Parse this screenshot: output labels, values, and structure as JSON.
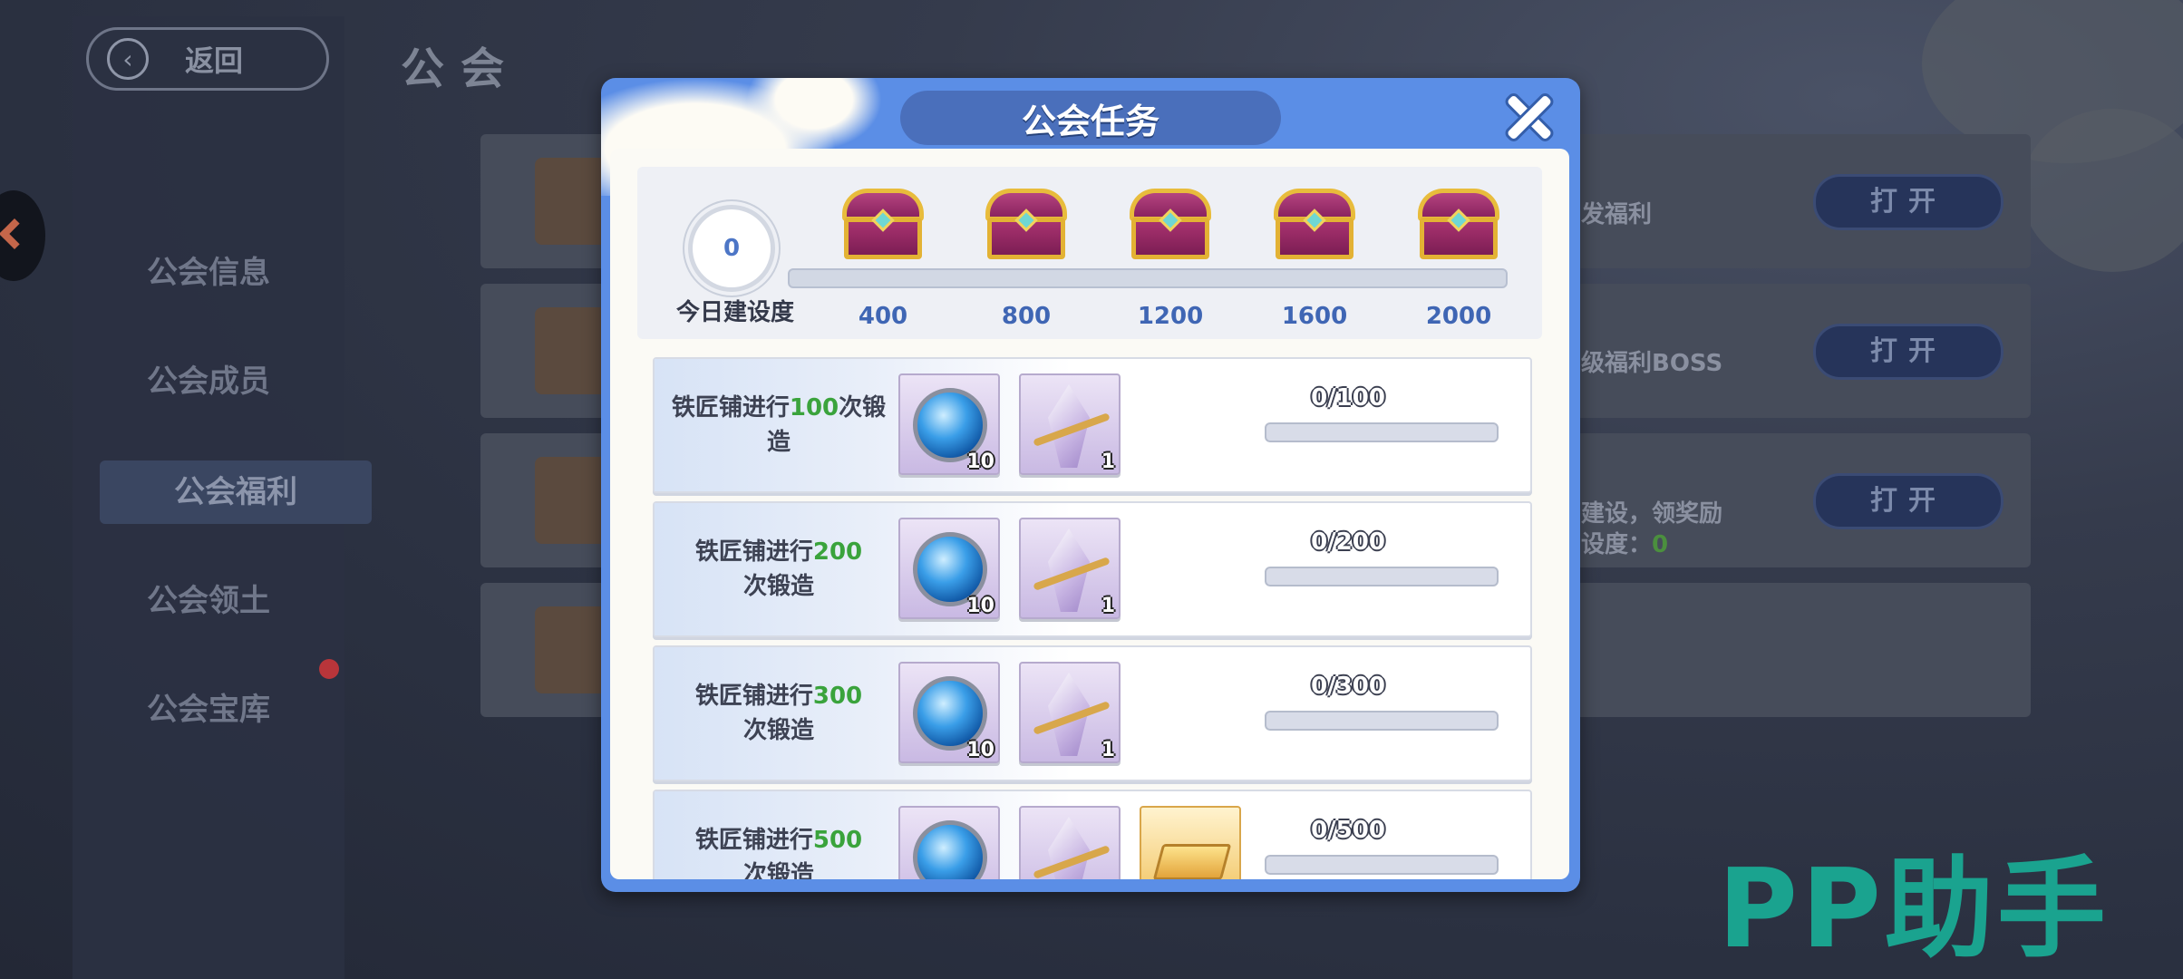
{
  "header": {
    "back_label": "返回",
    "page_title": "公会"
  },
  "sidebar": {
    "items": [
      {
        "label": "公会信息"
      },
      {
        "label": "公会成员"
      },
      {
        "label": "公会福利",
        "active": true
      },
      {
        "label": "公会领土"
      },
      {
        "label": "公会宝库"
      }
    ]
  },
  "background_rows": [
    {
      "text": "发福利",
      "button": "打开"
    },
    {
      "text": "级福利BOSS",
      "button": "打开"
    },
    {
      "text": "建设，领奖励",
      "text2_prefix": "设度：",
      "text2_value": "0",
      "button": "打开"
    }
  ],
  "modal": {
    "title": "公会任务",
    "close_icon": "close-icon",
    "today_value": "0",
    "today_label": "今日建设度",
    "progress_fraction": 0,
    "milestones": [
      "400",
      "800",
      "1200",
      "1600",
      "2000"
    ],
    "tasks": [
      {
        "prefix": "铁匠铺进行",
        "num": "100",
        "suffix": "次锻造",
        "progress": "0/100",
        "fraction": 0,
        "rewards": [
          {
            "icon": "water-orb-icon",
            "count": "10"
          },
          {
            "icon": "crystal-icon",
            "count": "1"
          }
        ]
      },
      {
        "prefix": "铁匠铺进行",
        "num": "200",
        "suffix": "次锻造",
        "progress": "0/200",
        "fraction": 0,
        "rewards": [
          {
            "icon": "water-orb-icon",
            "count": "10"
          },
          {
            "icon": "crystal-icon",
            "count": "1"
          }
        ]
      },
      {
        "prefix": "铁匠铺进行",
        "num": "300",
        "suffix": "次锻造",
        "progress": "0/300",
        "fraction": 0,
        "rewards": [
          {
            "icon": "water-orb-icon",
            "count": "10"
          },
          {
            "icon": "crystal-icon",
            "count": "1"
          }
        ]
      },
      {
        "prefix": "铁匠铺进行",
        "num": "500",
        "suffix": "次锻造",
        "progress": "0/500",
        "fraction": 0,
        "rewards": [
          {
            "icon": "water-orb-icon",
            "count": ""
          },
          {
            "icon": "crystal-icon",
            "count": ""
          },
          {
            "icon": "gold-bar-icon",
            "count": ""
          }
        ]
      }
    ]
  },
  "watermark": "PP助手",
  "colors": {
    "modal_blue": "#5b8ee6",
    "highlight_green": "#3aa33c",
    "milestone_blue": "#3f66b4"
  }
}
